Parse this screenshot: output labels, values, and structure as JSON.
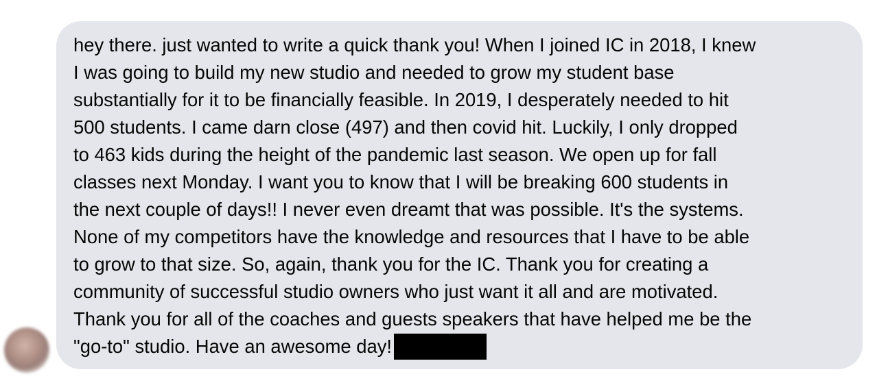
{
  "message": {
    "lines": [
      "hey there. just wanted to write a quick thank you! When I joined IC in 2018, I knew",
      "I was going to build my new studio and needed to grow my student base",
      "substantially for it to be financially feasible. In 2019, I desperately needed to hit",
      "500 students. I came darn close (497) and then covid hit. Luckily, I only dropped",
      "to 463 kids during the height of the pandemic last season. We open up for fall",
      "classes next Monday. I want you to know that I will be breaking 600 students in",
      "the next couple of days!! I never even dreamt that was possible. It's the systems.",
      "None of my competitors have the knowledge and resources that I have to be able",
      "to grow to that size. So, again, thank you for the IC. Thank you for creating a",
      "community of successful studio owners who just want it all and are motivated.",
      "Thank you for all of the coaches and guests speakers that have helped me be the",
      "\"go-to\" studio. Have an awesome day!"
    ]
  },
  "colors": {
    "bubble": "#e4e6eb",
    "text": "#050505",
    "redaction": "#000000"
  }
}
